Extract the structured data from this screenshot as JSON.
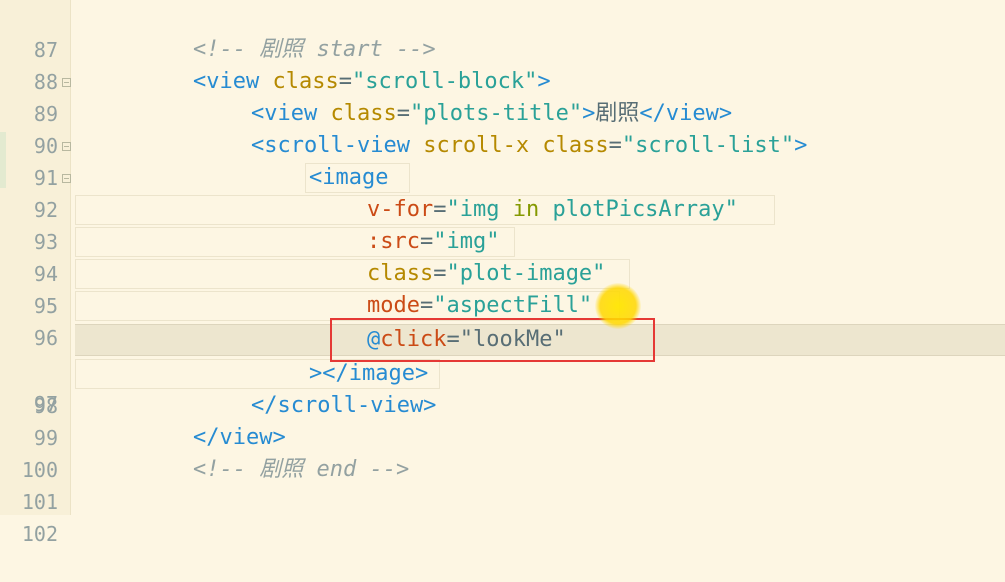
{
  "editor": {
    "lines": [
      {
        "num": "87"
      },
      {
        "num": "88",
        "comment": "<!-- 剧照 start -->"
      },
      {
        "num": "89",
        "open": "<view",
        "attr1": "class",
        "str1": "\"scroll-block\"",
        "close": ">"
      },
      {
        "num": "90",
        "open": "<view",
        "attr1": "class",
        "str1": "\"plots-title\"",
        "close": ">",
        "text": "剧照",
        "endtag": "</view>"
      },
      {
        "num": "91",
        "open": "<scroll-view",
        "attr0": "scroll-x",
        "attr1": "class",
        "str1": "\"scroll-list\"",
        "close": ">"
      },
      {
        "num": "92",
        "open": "<image"
      },
      {
        "num": "93",
        "attr1": "v-for",
        "q1": "\"img",
        "kw": "in",
        "rest": "plotPicsArray\""
      },
      {
        "num": "94",
        "attr1": ":src",
        "str1": "\"img\""
      },
      {
        "num": "95",
        "attr1": "class",
        "str1": "\"plot-image\""
      },
      {
        "num": "96",
        "attr1": "mode",
        "str1": "\"aspectFill\""
      },
      {
        "num": "97",
        "at": "@",
        "attr1": "click",
        "str1": "\"lookMe\""
      },
      {
        "num": "98",
        "close": "></image>"
      },
      {
        "num": "99",
        "endtag": "</scroll-view>"
      },
      {
        "num": "100",
        "endtag": "</view>"
      },
      {
        "num": "101",
        "comment": "<!-- 剧照 end -->"
      },
      {
        "num": "102"
      }
    ],
    "current_line": "97",
    "highlight_color": "#e53935",
    "cursor_color": "#ffd600"
  }
}
